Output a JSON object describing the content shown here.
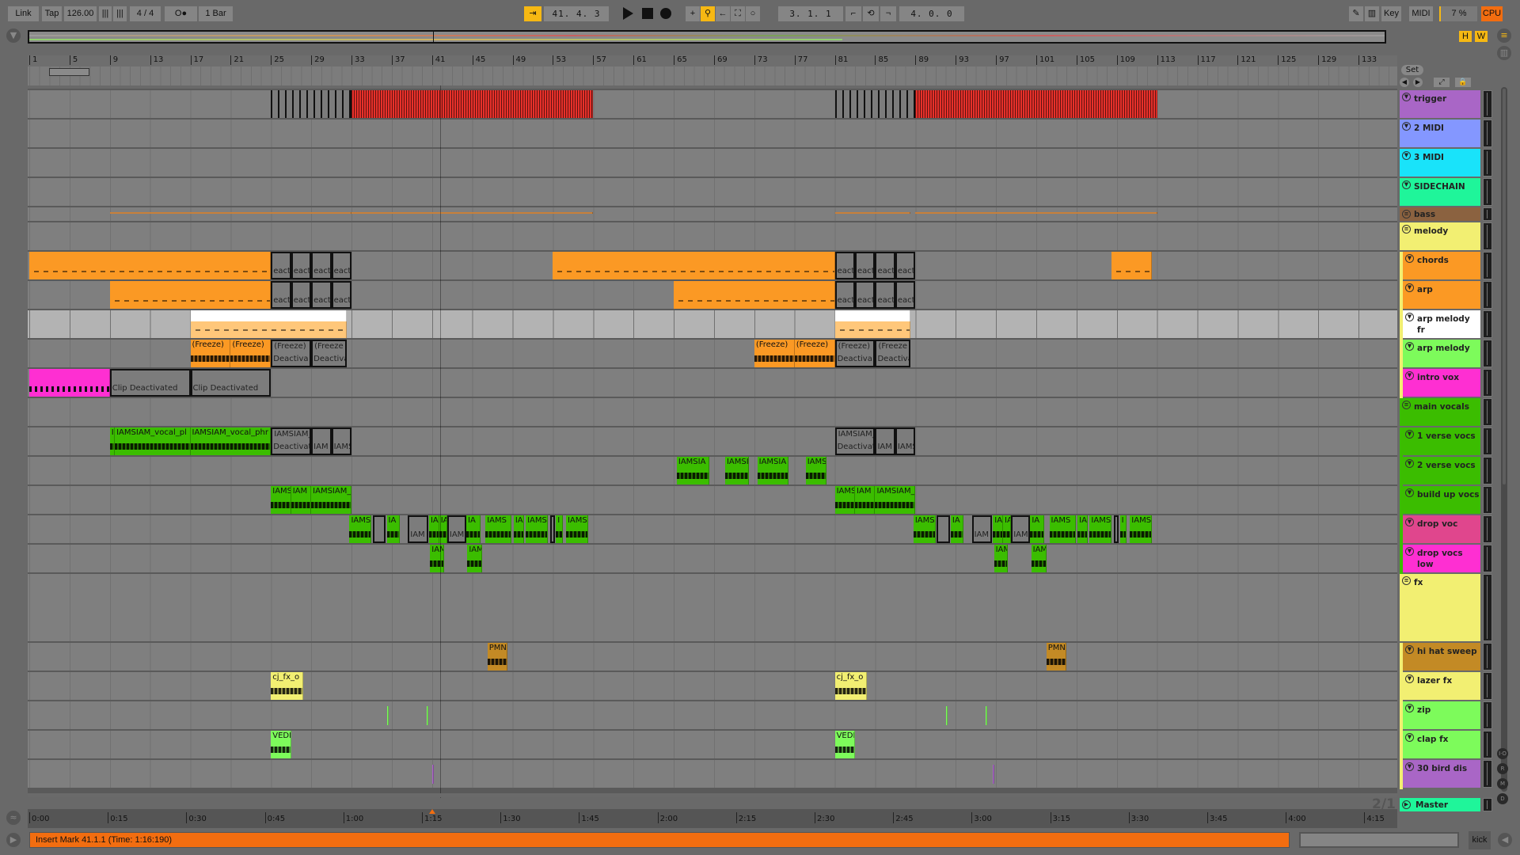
{
  "toolbar": {
    "link": "Link",
    "tap": "Tap",
    "tempo": "126.00",
    "signature": "4 / 4",
    "metronome": "O●",
    "quantize": "1 Bar",
    "position": "41. 4. 3",
    "loop_start": "3. 1. 1",
    "loop_length": "4. 0. 0",
    "key": "Key",
    "midi": "MIDI",
    "cpu_value": "7 %",
    "cpu": "CPU"
  },
  "overview": {
    "h": "H",
    "w": "W"
  },
  "ruler": {
    "bars": [
      "1",
      "5",
      "9",
      "13",
      "17",
      "21",
      "25",
      "29",
      "33",
      "37",
      "41",
      "45",
      "49",
      "53",
      "57",
      "61",
      "65",
      "69",
      "73",
      "77",
      "81",
      "85",
      "89",
      "93",
      "97",
      "101",
      "105",
      "109",
      "113",
      "117",
      "121",
      "125",
      "129",
      "133"
    ],
    "set": "Set",
    "loop_bars": [
      3,
      7
    ],
    "playhead_bar": 41.8
  },
  "time_ruler": [
    "0:00",
    "0:15",
    "0:30",
    "0:45",
    "1:00",
    "1:15",
    "1:30",
    "1:45",
    "2:00",
    "2:15",
    "2:30",
    "2:45",
    "3:00",
    "3:15",
    "3:30",
    "3:45",
    "4:00",
    "4:15"
  ],
  "tracks": [
    {
      "name": "trigger",
      "color": "#a966c6",
      "clips": [
        [
          25,
          33,
          "",
          "deact-trig"
        ],
        [
          33,
          57,
          "",
          "trig"
        ],
        [
          81,
          89,
          "",
          "deact-trig"
        ],
        [
          89,
          113,
          "",
          "trig"
        ]
      ]
    },
    {
      "name": "2 MIDI",
      "color": "#8497ff",
      "clips": []
    },
    {
      "name": "3 MIDI",
      "color": "#19e3fa",
      "clips": []
    },
    {
      "name": "SIDECHAIN",
      "color": "#1ff59a",
      "clips": []
    },
    {
      "name": "bass",
      "color": "#8b6240",
      "group": true,
      "clips": [
        [
          9,
          33,
          "",
          "line"
        ],
        [
          33,
          57,
          "",
          "line"
        ],
        [
          81,
          88.5,
          "",
          "line"
        ],
        [
          89,
          113,
          "",
          "line"
        ]
      ]
    },
    {
      "name": "melody",
      "color": "#f2ef72",
      "group": true,
      "clips": []
    },
    {
      "name": "chords",
      "color": "#fb9924",
      "child": true,
      "clips": [
        [
          1,
          25,
          "",
          "midi"
        ],
        [
          25,
          27,
          "eacti",
          "deact"
        ],
        [
          27,
          29,
          "eacti",
          "deact"
        ],
        [
          29,
          31,
          "eacti",
          "deact"
        ],
        [
          31,
          33,
          "eacti",
          "deact"
        ],
        [
          53,
          81,
          "",
          "midi"
        ],
        [
          81,
          83,
          "eacti",
          "deact"
        ],
        [
          83,
          85,
          "eacti",
          "deact"
        ],
        [
          85,
          87,
          "eacti",
          "deact"
        ],
        [
          87,
          89,
          "eacti",
          "deact"
        ],
        [
          108.5,
          112.5,
          "",
          "midi"
        ]
      ]
    },
    {
      "name": "arp",
      "color": "#fb9924",
      "child": true,
      "clips": [
        [
          9,
          25,
          "",
          "midi"
        ],
        [
          25,
          27,
          "eacti",
          "deact"
        ],
        [
          27,
          29,
          "eacti",
          "deact"
        ],
        [
          29,
          31,
          "eacti",
          "deact"
        ],
        [
          31,
          33,
          "eacti",
          "deact"
        ],
        [
          65,
          81,
          "",
          "midi"
        ],
        [
          81,
          83,
          "eacti",
          "deact"
        ],
        [
          83,
          85,
          "eacti",
          "deact"
        ],
        [
          85,
          87,
          "eacti",
          "deact"
        ],
        [
          87,
          89,
          "eacti",
          "deact"
        ]
      ]
    },
    {
      "name": "arp melody fr",
      "color": "#ffffff",
      "child": true,
      "frozen": true,
      "clips": [
        [
          17,
          32.5,
          "",
          "midi-light"
        ],
        [
          81,
          88.5,
          "",
          "midi-light"
        ]
      ]
    },
    {
      "name": "arp melody",
      "color": "#7dfb5b",
      "child": true,
      "clips": [
        [
          17,
          21,
          "(Freeze)",
          "audio-o"
        ],
        [
          21,
          25,
          "(Freeze)",
          "audio-o"
        ],
        [
          25,
          29,
          "(Freeze)",
          "deact",
          "Deactiva"
        ],
        [
          29,
          32.5,
          "(Freeze",
          "deact",
          "Deactiva"
        ],
        [
          73,
          77,
          "(Freeze)",
          "audio-o"
        ],
        [
          77,
          81,
          "(Freeze)",
          "audio-o"
        ],
        [
          81,
          85,
          "(Freeze)",
          "deact",
          "Deactiva"
        ],
        [
          85,
          88.5,
          "(Freeze",
          "deact",
          "Deactiva"
        ]
      ]
    },
    {
      "name": "intro vox",
      "color": "#fe2fd2",
      "child": true,
      "clips": [
        [
          1,
          9,
          "",
          "pink"
        ],
        [
          9,
          17,
          "",
          "deact",
          "Clip Deactivated"
        ],
        [
          17,
          25,
          "",
          "deact",
          "Clip Deactivated"
        ]
      ]
    },
    {
      "name": "main vocals",
      "color": "#3bbd00",
      "group": true,
      "clips": []
    },
    {
      "name": "1 verse vocs",
      "color": "#3bbd00",
      "child": true,
      "clips": [
        [
          9,
          9.5,
          "I",
          "audio"
        ],
        [
          9.5,
          17,
          "IAMSIAM_vocal_pl",
          "audio"
        ],
        [
          17,
          25,
          "IAMSIAM_vocal_phr",
          "audio"
        ],
        [
          25,
          29,
          "IAMSIAM_",
          "deact",
          "Deactivat"
        ],
        [
          29,
          31,
          "IAM",
          "deact"
        ],
        [
          31,
          33,
          "IAMS",
          "deact"
        ],
        [
          81,
          85,
          "IAMSIAM_",
          "deact",
          "Deactivat"
        ],
        [
          85,
          87,
          "IAM",
          "deact"
        ],
        [
          87,
          89,
          "IAMS",
          "deact"
        ]
      ]
    },
    {
      "name": "2 verse vocs",
      "color": "#3bbd00",
      "child": true,
      "clips": [
        [
          65.3,
          68.5,
          "IAMSIA",
          "audio"
        ],
        [
          70.1,
          72.5,
          "IAMSI",
          "audio"
        ],
        [
          73.3,
          76.4,
          "IAMSIA",
          "audio"
        ],
        [
          78.1,
          80.2,
          "IAMS",
          "audio"
        ]
      ]
    },
    {
      "name": "build up vocs",
      "color": "#3bbd00",
      "child": true,
      "clips": [
        [
          25,
          27,
          "IAMS",
          "audio"
        ],
        [
          27,
          29,
          "IAM",
          "audio"
        ],
        [
          29,
          33,
          "IAMSIAM_",
          "audio"
        ],
        [
          81,
          83,
          "IAMS",
          "audio"
        ],
        [
          83,
          85,
          "IAM",
          "audio"
        ],
        [
          85,
          89,
          "IAMSIAM_",
          "audio"
        ]
      ]
    },
    {
      "name": "drop voc",
      "color": "#e0468d",
      "child": true,
      "clips": [
        [
          32.8,
          35,
          "IAMS",
          "audio-g"
        ],
        [
          35.1,
          36.4,
          "",
          "deact"
        ],
        [
          36.5,
          37.8,
          "IA",
          "audio-g"
        ],
        [
          38.6,
          40.6,
          "IAM",
          "deact"
        ],
        [
          40.7,
          41.7,
          "IA",
          "audio-g"
        ],
        [
          41.7,
          42.5,
          "IA",
          "audio-g"
        ],
        [
          42.5,
          44.4,
          "IAM",
          "deact"
        ],
        [
          44.4,
          45.8,
          "IA",
          "audio-g"
        ],
        [
          46.3,
          48.9,
          "IAMS",
          "audio-g"
        ],
        [
          49.1,
          50.1,
          "IA",
          "audio-g"
        ],
        [
          50.3,
          52.5,
          "IAMS",
          "audio-g"
        ],
        [
          52.7,
          53.2,
          "",
          "deact"
        ],
        [
          53.3,
          54,
          "I",
          "audio-g"
        ],
        [
          54.3,
          56.5,
          "IAMS",
          "audio-g"
        ],
        [
          88.8,
          91,
          "IAMS",
          "audio-g"
        ],
        [
          91.1,
          92.4,
          "",
          "deact"
        ],
        [
          92.5,
          93.8,
          "IA",
          "audio-g"
        ],
        [
          94.6,
          96.6,
          "IAM",
          "deact"
        ],
        [
          96.7,
          97.7,
          "IA",
          "audio-g"
        ],
        [
          97.7,
          98.5,
          "IA",
          "audio-g"
        ],
        [
          98.5,
          100.4,
          "IAM",
          "deact"
        ],
        [
          100.4,
          101.8,
          "IA",
          "audio-g"
        ],
        [
          102.3,
          104.9,
          "IAMS",
          "audio-g"
        ],
        [
          105.1,
          106.1,
          "IA",
          "audio-g"
        ],
        [
          106.3,
          108.5,
          "IAMS",
          "audio-g"
        ],
        [
          108.7,
          109.2,
          "",
          "deact"
        ],
        [
          109.3,
          110,
          "I",
          "audio-g"
        ],
        [
          110.3,
          112.5,
          "IAMS",
          "audio-g"
        ]
      ]
    },
    {
      "name": "drop vocs low",
      "color": "#fe2fd2",
      "child": true,
      "clips": [
        [
          40.8,
          42.2,
          "IAM",
          "audio-g"
        ],
        [
          44.5,
          46,
          "IAM",
          "audio-g"
        ],
        [
          96.8,
          98.2,
          "IAM",
          "audio-g"
        ],
        [
          100.5,
          102,
          "IAM",
          "audio-g"
        ]
      ]
    },
    {
      "name": "fx",
      "color": "#f2ef72",
      "group": true,
      "clips": []
    },
    {
      "name": "hi hat sweep",
      "color": "#c38a25",
      "child": true,
      "clips": [
        [
          46.5,
          48.5,
          "PMN",
          "audio"
        ],
        [
          102,
          104,
          "PMN",
          "audio"
        ]
      ]
    },
    {
      "name": "lazer fx",
      "color": "#f2ef72",
      "child": true,
      "clips": [
        [
          25,
          28.2,
          "cj_fx_o",
          "audio"
        ],
        [
          81,
          84.2,
          "cj_fx_o",
          "audio"
        ]
      ]
    },
    {
      "name": "zip",
      "color": "#7dfb5b",
      "child": true,
      "clips": [
        [
          36.5,
          36.7,
          "",
          "tick"
        ],
        [
          40.5,
          40.7,
          "",
          "tick"
        ],
        [
          92,
          92.2,
          "",
          "tick"
        ],
        [
          96,
          96.2,
          "",
          "tick"
        ]
      ]
    },
    {
      "name": "clap fx",
      "color": "#7dfb5b",
      "child": true,
      "clips": [
        [
          25,
          27,
          "VEDI",
          "audio"
        ],
        [
          81,
          83,
          "VEDI",
          "audio"
        ]
      ]
    },
    {
      "name": "30 bird dis",
      "color": "#a966c6",
      "child": true,
      "clips": [
        [
          41,
          41.2,
          "",
          "tick"
        ],
        [
          96.7,
          96.9,
          "",
          "tick"
        ]
      ]
    }
  ],
  "master": {
    "name": "Master",
    "color": "#1ff59a"
  },
  "page_indicator": "2/1",
  "status": {
    "message": "Insert Mark 41.1.1 (Time: 1:16:190)",
    "track_name": "kick"
  },
  "side_buttons": [
    "I·O",
    "R",
    "M",
    "D"
  ]
}
